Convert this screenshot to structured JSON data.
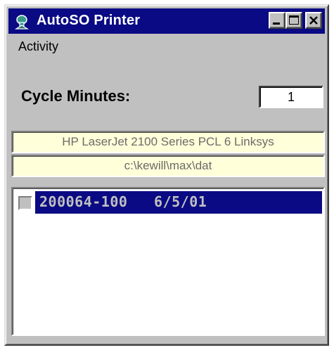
{
  "window": {
    "title": "AutoSO Printer",
    "icons": {
      "app": "app-icon",
      "minimize": "minimize-icon",
      "maximize": "maximize-icon",
      "close": "close-icon"
    }
  },
  "menu": {
    "items": [
      {
        "label": "Activity"
      }
    ]
  },
  "cycle": {
    "label": "Cycle Minutes:",
    "value": "1"
  },
  "info": {
    "printer": "HP LaserJet 2100 Series PCL 6 Linksys",
    "path": "c:\\kewill\\max\\dat"
  },
  "list": {
    "items": [
      {
        "text": "200064-100   6/5/01",
        "selected": true,
        "checked": false
      }
    ]
  },
  "colors": {
    "titlebar": "#0a0a84",
    "face": "#c0c0c0",
    "info_background": "#ffffd9",
    "info_text": "#6b6b6b",
    "selection": "#0a0a84"
  }
}
